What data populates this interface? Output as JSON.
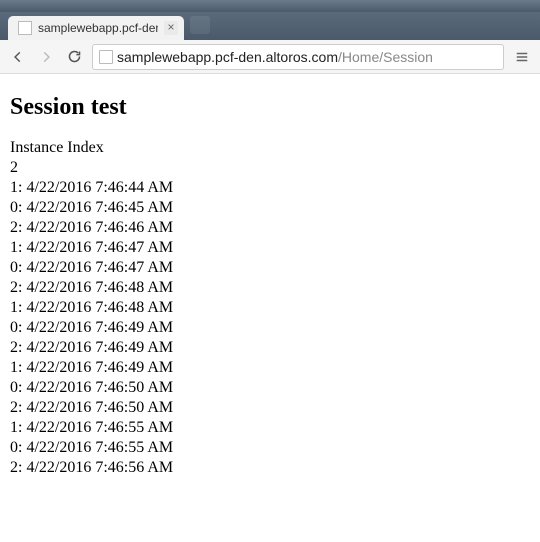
{
  "tab": {
    "title": "samplewebapp.pcf-den.al",
    "close_label": "×"
  },
  "url": {
    "host": "samplewebapp.pcf-den.altoros.com",
    "path": "/Home/Session"
  },
  "page": {
    "heading": "Session test",
    "label_instance_index": "Instance Index",
    "instance_index": "2",
    "log": [
      "1: 4/22/2016 7:46:44 AM",
      "0: 4/22/2016 7:46:45 AM",
      "2: 4/22/2016 7:46:46 AM",
      "1: 4/22/2016 7:46:47 AM",
      "0: 4/22/2016 7:46:47 AM",
      "2: 4/22/2016 7:46:48 AM",
      "1: 4/22/2016 7:46:48 AM",
      "0: 4/22/2016 7:46:49 AM",
      "2: 4/22/2016 7:46:49 AM",
      "1: 4/22/2016 7:46:49 AM",
      "0: 4/22/2016 7:46:50 AM",
      "2: 4/22/2016 7:46:50 AM",
      "1: 4/22/2016 7:46:55 AM",
      "0: 4/22/2016 7:46:55 AM",
      "2: 4/22/2016 7:46:56 AM"
    ]
  }
}
